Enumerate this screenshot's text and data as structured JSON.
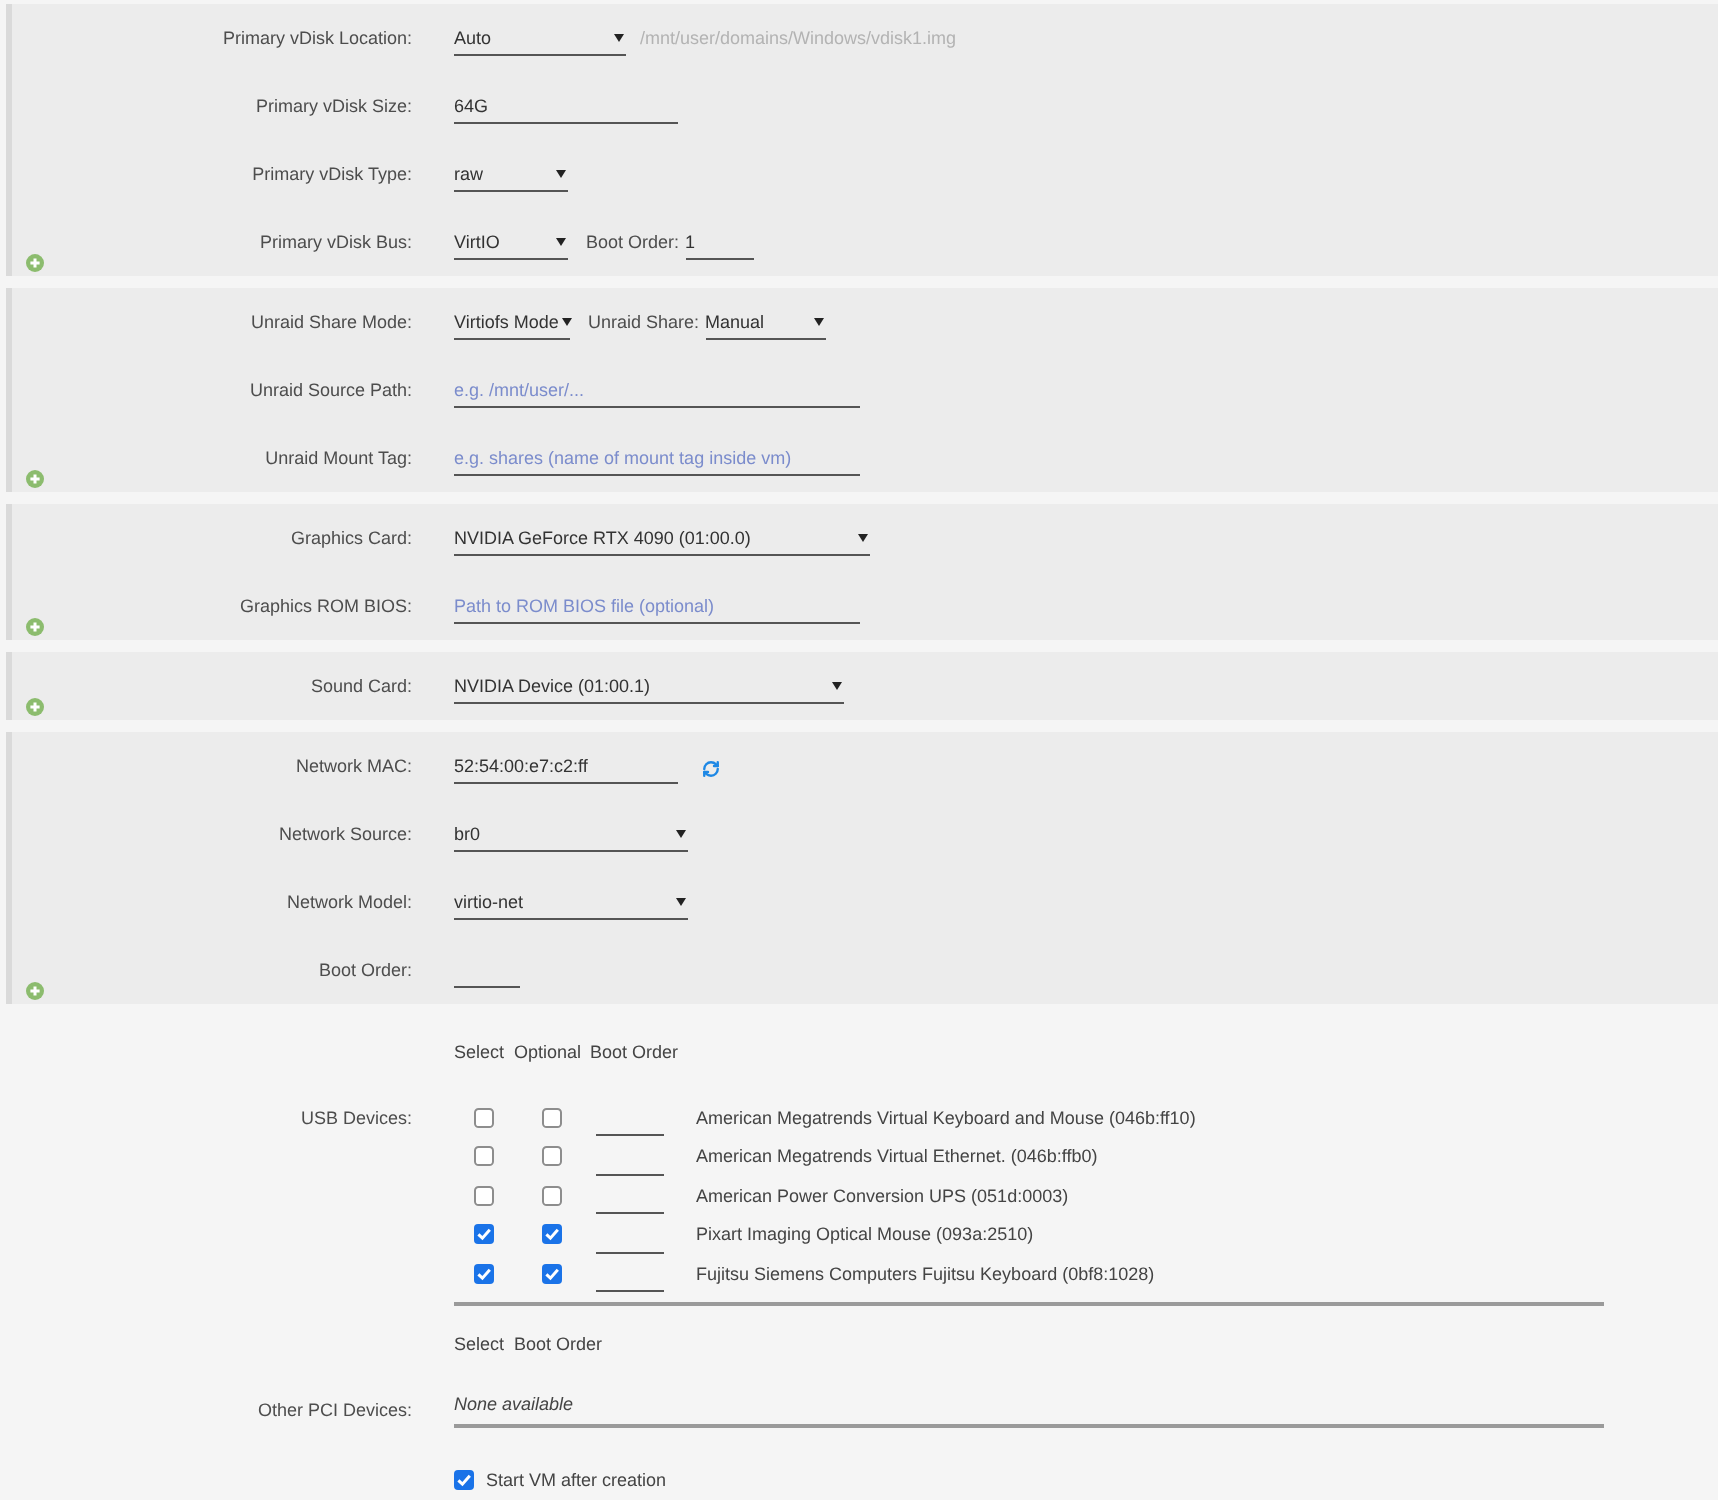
{
  "sections": [
    {
      "rows": [
        {
          "label": "Primary vDisk Location:",
          "controls": [
            {
              "kind": "select",
              "value": "Auto"
            },
            {
              "kind": "text",
              "text": "/mnt/user/domains/Windows/vdisk1.img"
            }
          ]
        },
        {
          "label": "Primary vDisk Size:",
          "controls": [
            {
              "kind": "input",
              "value": "64G"
            }
          ]
        },
        {
          "label": "Primary vDisk Type:",
          "controls": [
            {
              "kind": "select",
              "value": "raw"
            }
          ]
        },
        {
          "label": "Primary vDisk Bus:",
          "controls": [
            {
              "kind": "select",
              "value": "VirtIO"
            },
            {
              "kind": "label",
              "text": "Boot Order:"
            },
            {
              "kind": "input",
              "value": "1"
            }
          ]
        }
      ]
    },
    {
      "rows": [
        {
          "label": "Unraid Share Mode:",
          "controls": [
            {
              "kind": "select",
              "value": "Virtiofs Mode"
            },
            {
              "kind": "label",
              "text": "Unraid Share:"
            },
            {
              "kind": "select",
              "value": "Manual"
            }
          ]
        },
        {
          "label": "Unraid Source Path:",
          "controls": [
            {
              "kind": "input",
              "placeholder": "e.g. /mnt/user/..."
            }
          ]
        },
        {
          "label": "Unraid Mount Tag:",
          "controls": [
            {
              "kind": "input",
              "placeholder": "e.g. shares (name of mount tag inside vm)"
            }
          ]
        }
      ]
    },
    {
      "rows": [
        {
          "label": "Graphics Card:",
          "controls": [
            {
              "kind": "select",
              "value": "NVIDIA GeForce RTX 4090 (01:00.0)"
            }
          ]
        },
        {
          "label": "Graphics ROM BIOS:",
          "controls": [
            {
              "kind": "input",
              "placeholder": "Path to ROM BIOS file (optional)"
            }
          ]
        }
      ]
    },
    {
      "rows": [
        {
          "label": "Sound Card:",
          "controls": [
            {
              "kind": "select",
              "value": "NVIDIA Device (01:00.1)"
            }
          ]
        }
      ]
    },
    {
      "rows": [
        {
          "label": "Network MAC:",
          "controls": [
            {
              "kind": "input",
              "value": "52:54:00:e7:c2:ff"
            },
            {
              "kind": "icon_button"
            }
          ]
        },
        {
          "label": "Network Source:",
          "controls": [
            {
              "kind": "select",
              "value": "br0"
            }
          ]
        },
        {
          "label": "Network Model:",
          "controls": [
            {
              "kind": "select",
              "value": "virtio-net"
            }
          ]
        },
        {
          "label": "Boot Order:",
          "controls": [
            {
              "kind": "input"
            }
          ]
        }
      ]
    }
  ],
  "usb_devices": {
    "label": "USB Devices:",
    "columns": [
      "Select",
      "Optional",
      "Boot Order"
    ],
    "rows": [
      {
        "select_checked": false,
        "optional_checked": false,
        "name": "American Megatrends Virtual Keyboard and Mouse (046b:ff10)"
      },
      {
        "select_checked": false,
        "optional_checked": false,
        "name": "American Megatrends Virtual Ethernet. (046b:ffb0)"
      },
      {
        "select_checked": false,
        "optional_checked": false,
        "name": "American Power Conversion UPS (051d:0003)"
      },
      {
        "select_checked": true,
        "optional_checked": true,
        "name": "Pixart Imaging Optical Mouse (093a:2510)"
      },
      {
        "select_checked": true,
        "optional_checked": true,
        "name": "Fujitsu Siemens Computers Fujitsu Keyboard (0bf8:1028)"
      }
    ]
  },
  "other_pci_devices": {
    "label": "Other PCI Devices:",
    "columns": [
      "Select",
      "Boot Order"
    ],
    "empty_text": "None available"
  },
  "start_vm": {
    "label": "Start VM after creation",
    "checked": true
  }
}
